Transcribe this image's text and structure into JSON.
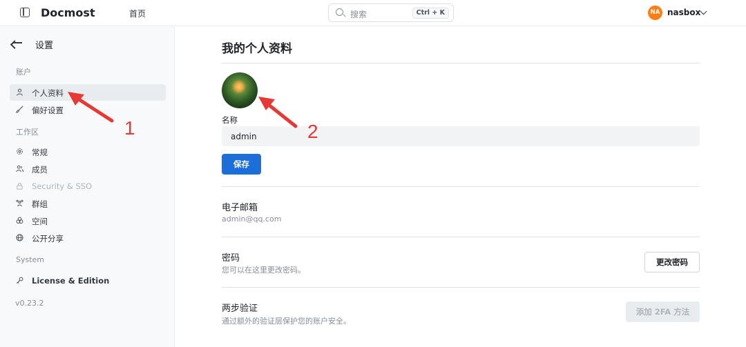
{
  "header": {
    "brand": "Docmost",
    "home_link": "首页",
    "search": {
      "placeholder": "搜索",
      "shortcut": "Ctrl + K"
    },
    "user": {
      "initials": "NA",
      "name": "nasbox",
      "avatar_color": "#fd7e14"
    }
  },
  "sidebar": {
    "title": "设置",
    "sections": [
      {
        "label": "账户",
        "items": [
          {
            "label": "个人资料",
            "icon": "user-icon",
            "active": true
          },
          {
            "label": "偏好设置",
            "icon": "brush-icon"
          }
        ]
      },
      {
        "label": "工作区",
        "items": [
          {
            "label": "常规",
            "icon": "gear-icon"
          },
          {
            "label": "成员",
            "icon": "users-icon"
          },
          {
            "label": "Security & SSO",
            "icon": "lock-icon",
            "disabled": true
          },
          {
            "label": "群组",
            "icon": "group-icon"
          },
          {
            "label": "空间",
            "icon": "spaces-icon"
          },
          {
            "label": "公开分享",
            "icon": "globe-icon"
          }
        ]
      },
      {
        "label": "System",
        "items": [
          {
            "label": "License & Edition",
            "icon": "key-icon"
          }
        ]
      }
    ],
    "version": "v0.23.2"
  },
  "main": {
    "title": "我的个人资料",
    "name_label": "名称",
    "name_value": "admin",
    "save_label": "保存",
    "email_title": "电子邮箱",
    "email_value": "admin@qq.com",
    "password_title": "密码",
    "password_desc": "您可以在这里更改密码。",
    "password_button": "更改密码",
    "twofa_title": "两步验证",
    "twofa_desc": "通过额外的验证层保护您的账户安全。",
    "twofa_button": "添加 2FA 方法"
  },
  "annotations": {
    "marker_1": "1",
    "marker_2": "2",
    "color": "#e53935"
  },
  "colors": {
    "primary": "#1c6ed8",
    "sidebar_bg": "#f8f9fa",
    "active_bg": "#e9ecef"
  }
}
